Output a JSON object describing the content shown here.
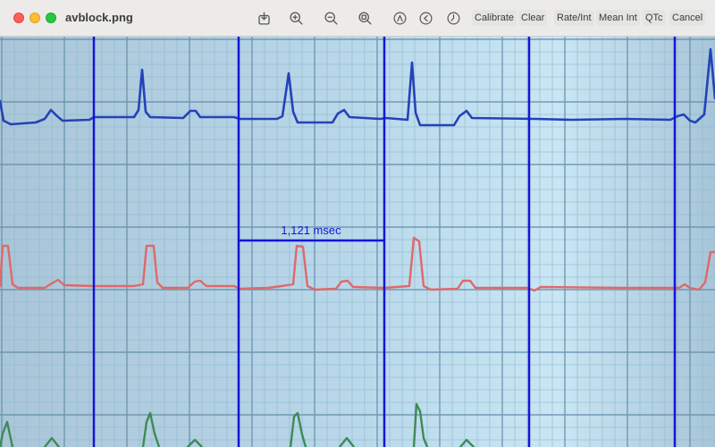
{
  "window": {
    "title": "avblock.png"
  },
  "toolbar": {
    "icons": [
      "export-icon",
      "zoom-in-icon",
      "zoom-out-icon",
      "zoom-to-fit-icon",
      "markup-icon",
      "rotate-left-icon",
      "rotate-clockwise-icon"
    ],
    "buttons": {
      "calibrate": "Calibrate",
      "clear": "Clear",
      "rate_int": "Rate/Int",
      "mean_int": "Mean Int",
      "qtc": "QTc",
      "cancel": "Cancel"
    }
  },
  "measurement": {
    "label": "1,121 msec",
    "color": "#1414d8"
  },
  "colors": {
    "grid_background": "#bcd9e9",
    "grid_minor": "#8fb6ce",
    "grid_major": "#5d8aa6",
    "caliper": "#1414d8",
    "trace_lead1": "#2442b8",
    "trace_lead2": "#e0686a",
    "trace_lead3": "#3f8a55"
  }
}
